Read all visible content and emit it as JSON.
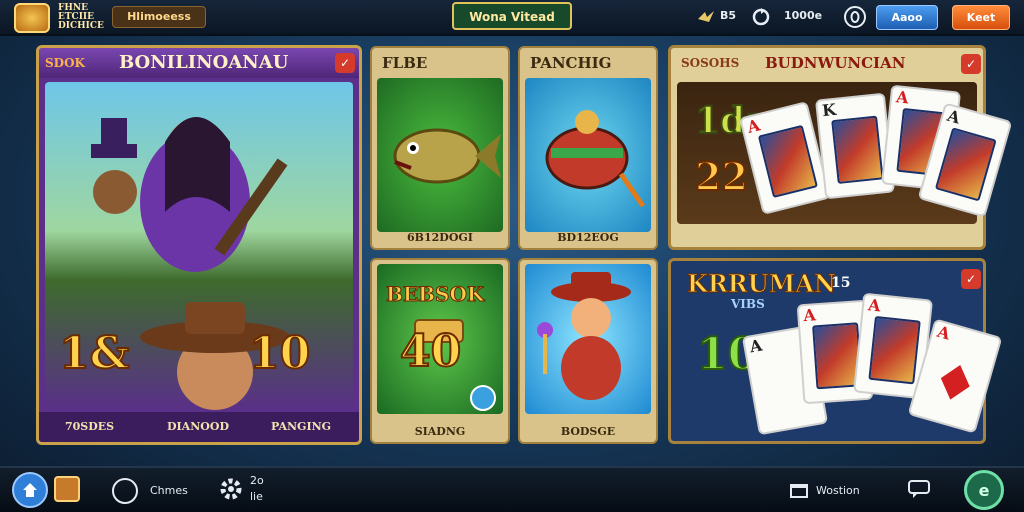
{
  "header": {
    "logo_lines": [
      "FHNE",
      "ETCIIE",
      "DICHICE"
    ],
    "tab_label": "Hlimoeess",
    "center_banner": "Wona Vitead",
    "stat_a": "B5",
    "stat_b": "1000e",
    "button_blue": "Aaoo",
    "button_orange": "Keet"
  },
  "featured": {
    "label": "SDOK",
    "title": "BONILINOANAU",
    "left_number": "1&",
    "right_number": "10",
    "captions": [
      "70SDES",
      "DIANOOD",
      "PANGING"
    ]
  },
  "tiles": [
    {
      "title": "FLBE",
      "caption": "6B12DOGI"
    },
    {
      "title": "PANCHIG",
      "caption": "BD12EOG"
    },
    {
      "title": "BEBSOK",
      "number": "40",
      "caption": "SIADNG"
    },
    {
      "title": "",
      "caption": "BODSGE"
    }
  ],
  "right_top": {
    "label": "SOSOHS",
    "title": "BUDNWUNCIAN",
    "line1": "1da",
    "line2": "22"
  },
  "right_bottom": {
    "title": "KRRUMAN",
    "badge": "15",
    "subtitle": "VIBS",
    "number": "10"
  },
  "cards": [
    "A",
    "K",
    "A",
    "A",
    "A",
    "A",
    "A",
    "A"
  ],
  "bottombar": {
    "item_a": "Chmes",
    "item_b_line1": "2o",
    "item_b_line2": "lie",
    "item_c": "Wostion"
  },
  "colors": {
    "accent_gold": "#ffd34d",
    "panel_purple": "#5b2f8a",
    "button_blue": "#2f7fd8",
    "button_orange": "#f06a1c"
  }
}
